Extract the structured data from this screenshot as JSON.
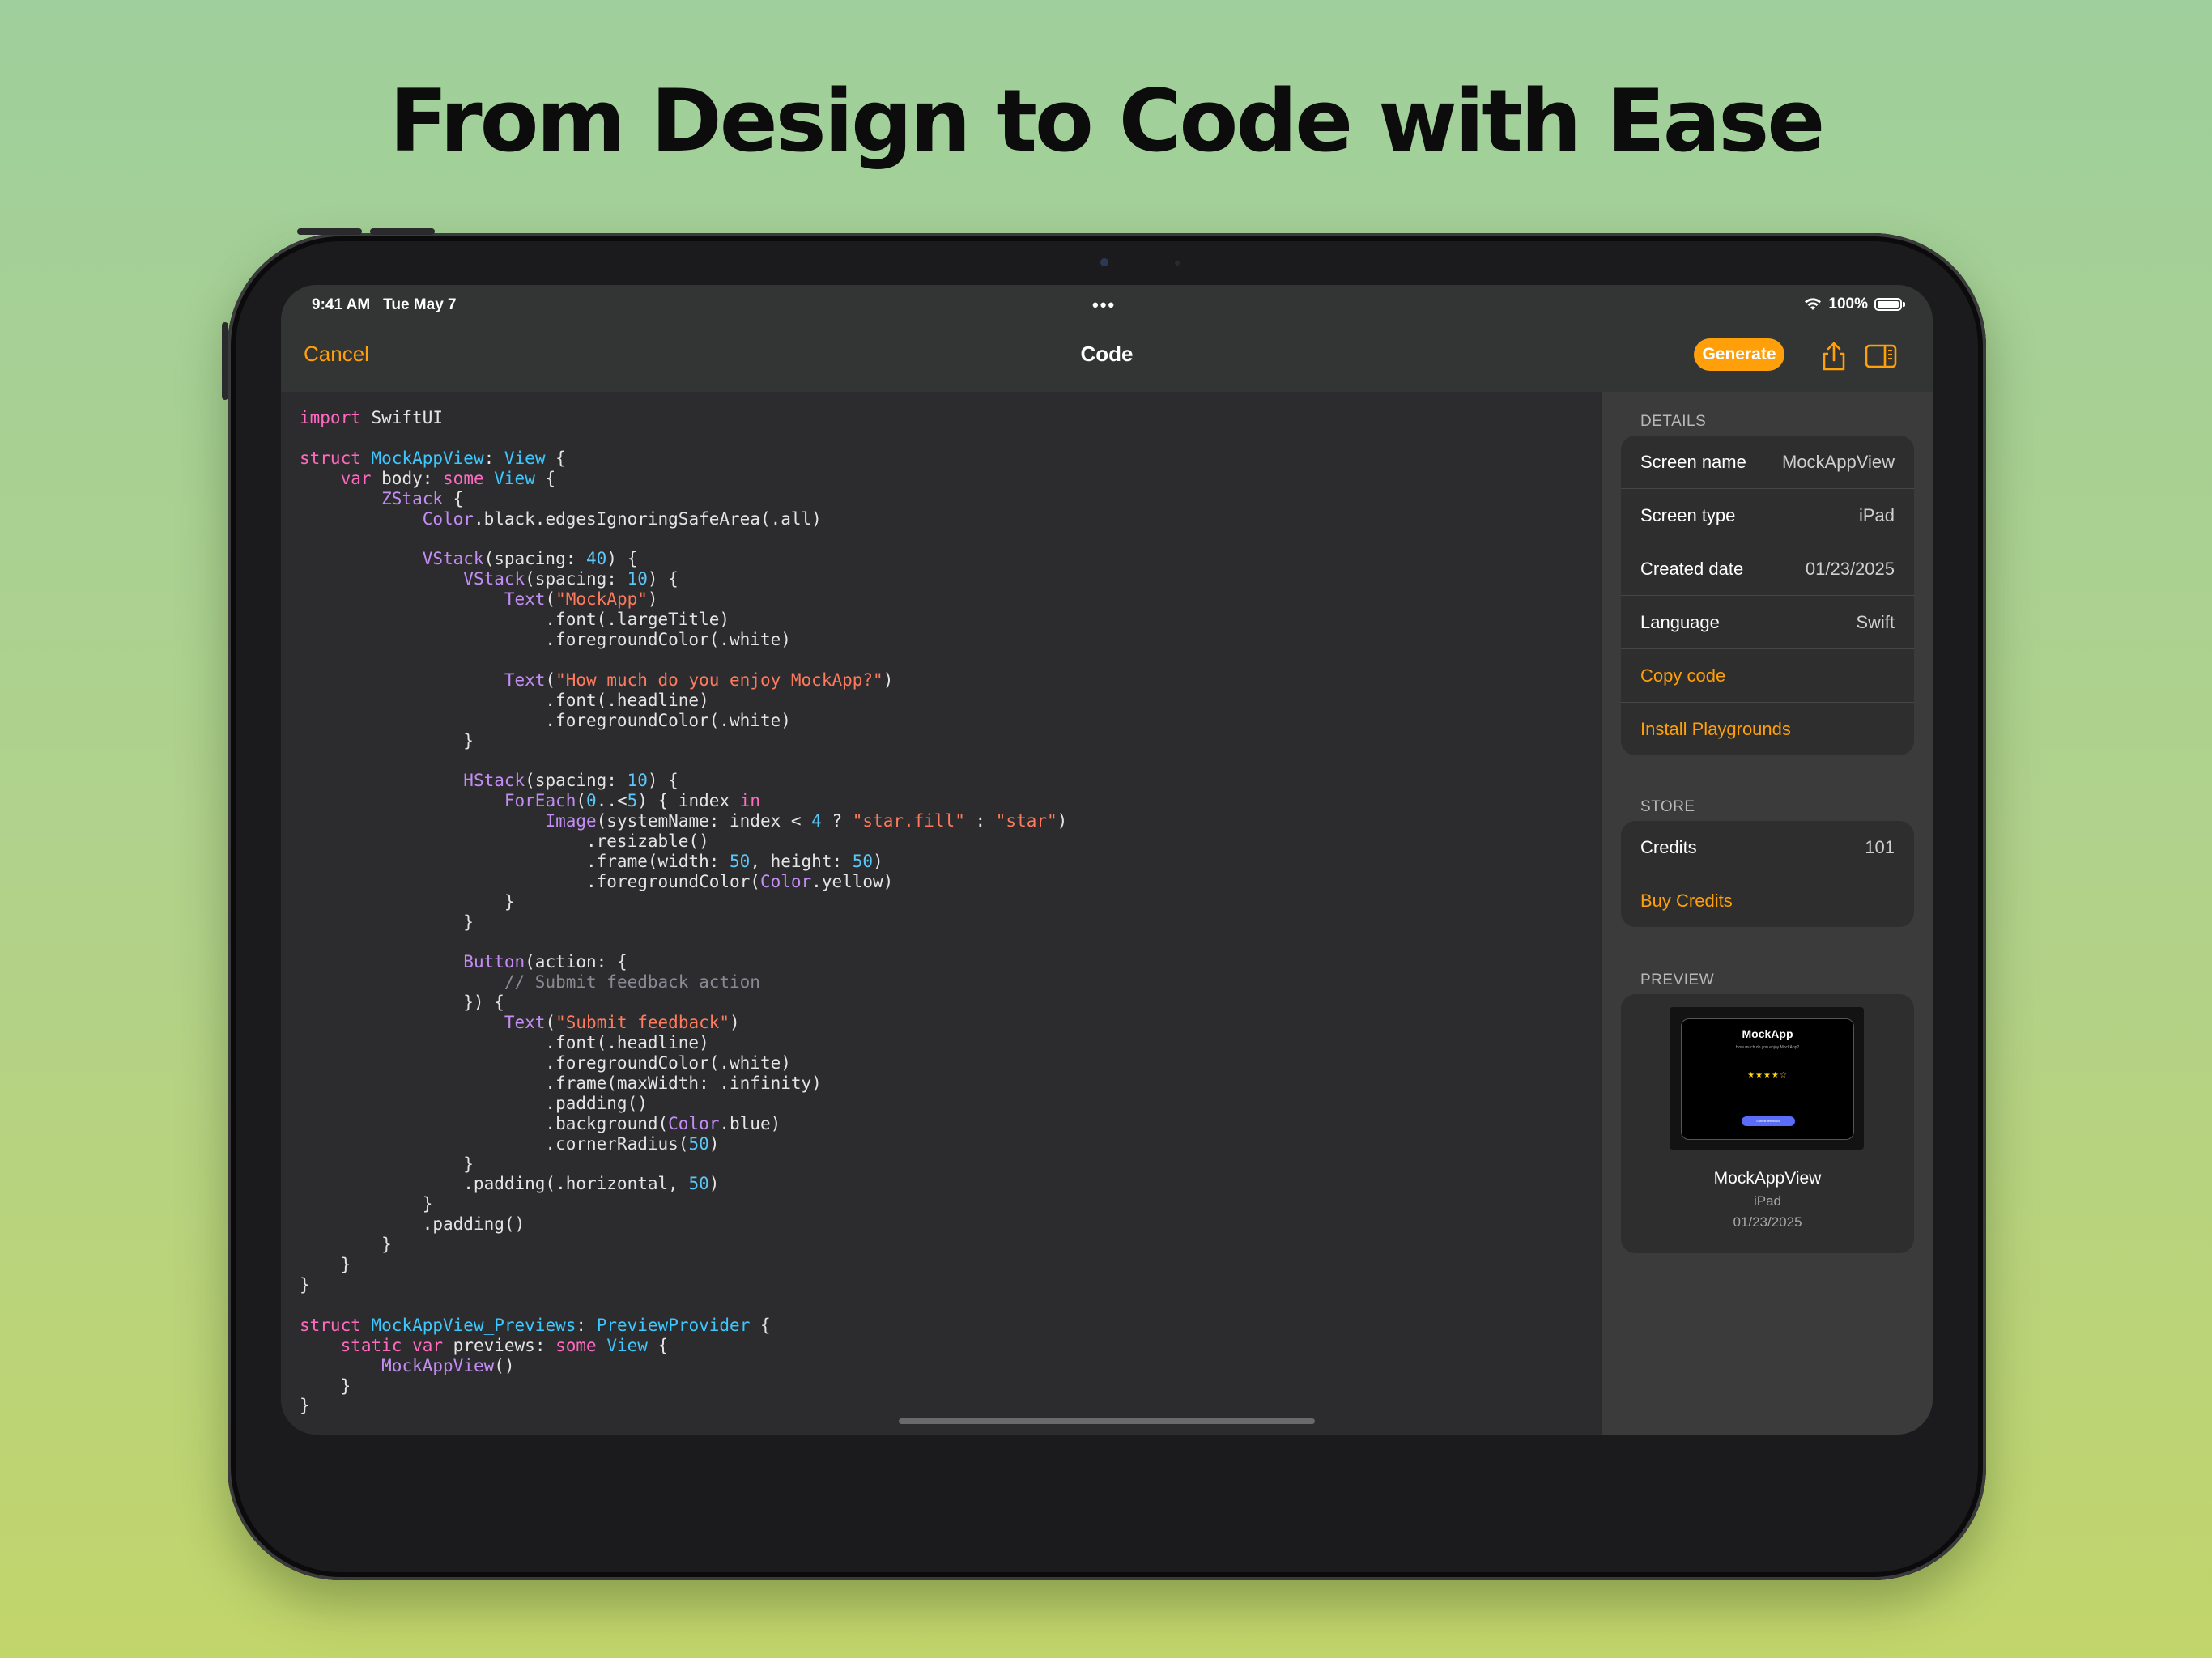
{
  "headline": "From Design to Code with Ease",
  "status_bar": {
    "time": "9:41 AM",
    "date": "Tue May 7",
    "dots": "•••",
    "battery": "100%",
    "battery_level": 1.0
  },
  "nav": {
    "cancel": "Cancel",
    "title": "Code",
    "generate": "Generate",
    "share_icon": "share-icon",
    "sidebar_icon": "sidebar-toggle-icon"
  },
  "colors": {
    "accent": "#ff9f0a",
    "keyword": "#ff6ac1",
    "type": "#3cc7ff",
    "function": "#c48df5",
    "string": "#ff7a5c",
    "number": "#5ac8fa",
    "comment": "#8a8a95"
  },
  "code": [
    [
      [
        "kw",
        "import"
      ],
      [
        "p",
        " SwiftUI"
      ]
    ],
    [],
    [
      [
        "kw",
        "struct"
      ],
      [
        "p",
        " "
      ],
      [
        "ty",
        "MockAppView"
      ],
      [
        "p",
        ": "
      ],
      [
        "ty",
        "View"
      ],
      [
        "p",
        " {"
      ]
    ],
    [
      [
        "p",
        "    "
      ],
      [
        "kw",
        "var"
      ],
      [
        "p",
        " body: "
      ],
      [
        "kw",
        "some"
      ],
      [
        "p",
        " "
      ],
      [
        "ty",
        "View"
      ],
      [
        "p",
        " {"
      ]
    ],
    [
      [
        "p",
        "        "
      ],
      [
        "fn",
        "ZStack"
      ],
      [
        "p",
        " {"
      ]
    ],
    [
      [
        "p",
        "            "
      ],
      [
        "fn",
        "Color"
      ],
      [
        "p",
        ".black.edgesIgnoringSafeArea(.all)"
      ]
    ],
    [],
    [
      [
        "p",
        "            "
      ],
      [
        "fn",
        "VStack"
      ],
      [
        "p",
        "(spacing: "
      ],
      [
        "nu",
        "40"
      ],
      [
        "p",
        ") {"
      ]
    ],
    [
      [
        "p",
        "                "
      ],
      [
        "fn",
        "VStack"
      ],
      [
        "p",
        "(spacing: "
      ],
      [
        "nu",
        "10"
      ],
      [
        "p",
        ") {"
      ]
    ],
    [
      [
        "p",
        "                    "
      ],
      [
        "fn",
        "Text"
      ],
      [
        "p",
        "("
      ],
      [
        "st",
        "\"MockApp\""
      ],
      [
        "p",
        ")"
      ]
    ],
    [
      [
        "p",
        "                        .font(.largeTitle)"
      ]
    ],
    [
      [
        "p",
        "                        .foregroundColor(.white)"
      ]
    ],
    [],
    [
      [
        "p",
        "                    "
      ],
      [
        "fn",
        "Text"
      ],
      [
        "p",
        "("
      ],
      [
        "st",
        "\"How much do you enjoy MockApp?\""
      ],
      [
        "p",
        ")"
      ]
    ],
    [
      [
        "p",
        "                        .font(.headline)"
      ]
    ],
    [
      [
        "p",
        "                        .foregroundColor(.white)"
      ]
    ],
    [
      [
        "p",
        "                }"
      ]
    ],
    [],
    [
      [
        "p",
        "                "
      ],
      [
        "fn",
        "HStack"
      ],
      [
        "p",
        "(spacing: "
      ],
      [
        "nu",
        "10"
      ],
      [
        "p",
        ") {"
      ]
    ],
    [
      [
        "p",
        "                    "
      ],
      [
        "fn",
        "ForEach"
      ],
      [
        "p",
        "("
      ],
      [
        "nu",
        "0"
      ],
      [
        "p",
        "..<"
      ],
      [
        "nu",
        "5"
      ],
      [
        "p",
        ") { index "
      ],
      [
        "kw",
        "in"
      ]
    ],
    [
      [
        "p",
        "                        "
      ],
      [
        "fn",
        "Image"
      ],
      [
        "p",
        "(systemName: index < "
      ],
      [
        "nu",
        "4"
      ],
      [
        "p",
        " ? "
      ],
      [
        "st",
        "\"star.fill\""
      ],
      [
        "p",
        " : "
      ],
      [
        "st",
        "\"star\""
      ],
      [
        "p",
        ")"
      ]
    ],
    [
      [
        "p",
        "                            .resizable()"
      ]
    ],
    [
      [
        "p",
        "                            .frame(width: "
      ],
      [
        "nu",
        "50"
      ],
      [
        "p",
        ", height: "
      ],
      [
        "nu",
        "50"
      ],
      [
        "p",
        ")"
      ]
    ],
    [
      [
        "p",
        "                            .foregroundColor("
      ],
      [
        "fn",
        "Color"
      ],
      [
        "p",
        ".yellow)"
      ]
    ],
    [
      [
        "p",
        "                    }"
      ]
    ],
    [
      [
        "p",
        "                }"
      ]
    ],
    [],
    [
      [
        "p",
        "                "
      ],
      [
        "fn",
        "Button"
      ],
      [
        "p",
        "(action: {"
      ]
    ],
    [
      [
        "p",
        "                    "
      ],
      [
        "cm",
        "// Submit feedback action"
      ]
    ],
    [
      [
        "p",
        "                }) {"
      ]
    ],
    [
      [
        "p",
        "                    "
      ],
      [
        "fn",
        "Text"
      ],
      [
        "p",
        "("
      ],
      [
        "st",
        "\"Submit feedback\""
      ],
      [
        "p",
        ")"
      ]
    ],
    [
      [
        "p",
        "                        .font(.headline)"
      ]
    ],
    [
      [
        "p",
        "                        .foregroundColor(.white)"
      ]
    ],
    [
      [
        "p",
        "                        .frame(maxWidth: .infinity)"
      ]
    ],
    [
      [
        "p",
        "                        .padding()"
      ]
    ],
    [
      [
        "p",
        "                        .background("
      ],
      [
        "fn",
        "Color"
      ],
      [
        "p",
        ".blue)"
      ]
    ],
    [
      [
        "p",
        "                        .cornerRadius("
      ],
      [
        "nu",
        "50"
      ],
      [
        "p",
        ")"
      ]
    ],
    [
      [
        "p",
        "                }"
      ]
    ],
    [
      [
        "p",
        "                .padding(.horizontal, "
      ],
      [
        "nu",
        "50"
      ],
      [
        "p",
        ")"
      ]
    ],
    [
      [
        "p",
        "            }"
      ]
    ],
    [
      [
        "p",
        "            .padding()"
      ]
    ],
    [
      [
        "p",
        "        }"
      ]
    ],
    [
      [
        "p",
        "    }"
      ]
    ],
    [
      [
        "p",
        "}"
      ]
    ],
    [],
    [
      [
        "kw",
        "struct"
      ],
      [
        "p",
        " "
      ],
      [
        "ty",
        "MockAppView_Previews"
      ],
      [
        "p",
        ": "
      ],
      [
        "ty",
        "PreviewProvider"
      ],
      [
        "p",
        " {"
      ]
    ],
    [
      [
        "p",
        "    "
      ],
      [
        "kw",
        "static"
      ],
      [
        "p",
        " "
      ],
      [
        "kw",
        "var"
      ],
      [
        "p",
        " previews: "
      ],
      [
        "kw",
        "some"
      ],
      [
        "p",
        " "
      ],
      [
        "ty",
        "View"
      ],
      [
        "p",
        " {"
      ]
    ],
    [
      [
        "p",
        "        "
      ],
      [
        "fn",
        "MockAppView"
      ],
      [
        "p",
        "()"
      ]
    ],
    [
      [
        "p",
        "    }"
      ]
    ],
    [
      [
        "p",
        "}"
      ]
    ]
  ],
  "sidebar": {
    "details": {
      "label": "DETAILS",
      "rows": [
        {
          "key": "Screen name",
          "value": "MockAppView"
        },
        {
          "key": "Screen type",
          "value": "iPad"
        },
        {
          "key": "Created date",
          "value": "01/23/2025"
        },
        {
          "key": "Language",
          "value": "Swift"
        }
      ],
      "copy_code": "Copy code",
      "install_playgrounds": "Install Playgrounds"
    },
    "store": {
      "label": "STORE",
      "credits_key": "Credits",
      "credits_value": "101",
      "buy_credits": "Buy Credits"
    },
    "preview": {
      "label": "PREVIEW",
      "thumb_title": "MockApp",
      "thumb_subtitle": "How much do you enjoy MockApp?",
      "thumb_stars": "★★★★☆",
      "thumb_button": "Submit feedback",
      "name": "MockAppView",
      "type": "iPad",
      "date": "01/23/2025"
    }
  }
}
